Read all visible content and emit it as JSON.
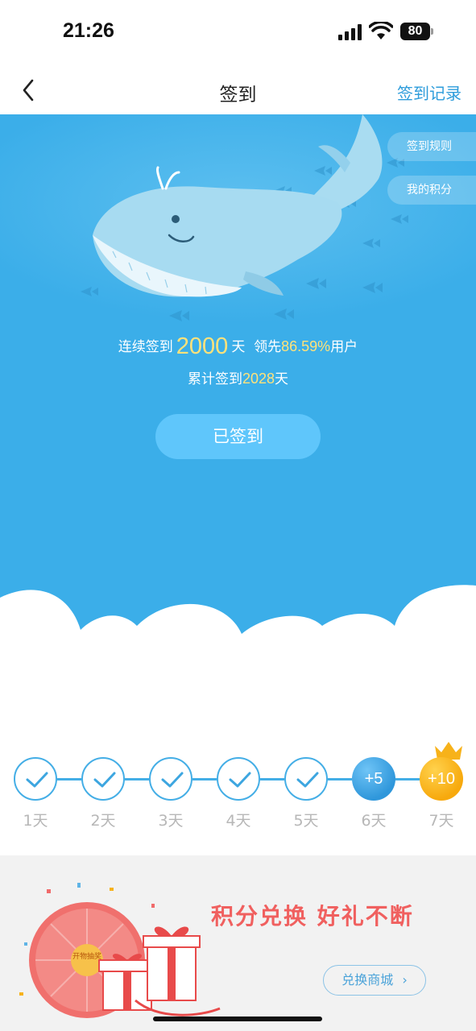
{
  "status_bar": {
    "time": "21:26",
    "battery": "80"
  },
  "nav": {
    "title": "签到",
    "record_link": "签到记录"
  },
  "hero": {
    "side_buttons": {
      "rules": "签到规则",
      "my_points": "我的积分"
    },
    "stats": {
      "streak_prefix": "连续签到",
      "streak_days": "2000",
      "streak_unit": "天",
      "lead_prefix": "领先",
      "lead_percent": "86.59%",
      "lead_suffix": "用户",
      "total_prefix": "累计签到",
      "total_days": "2028",
      "total_unit": "天"
    },
    "checkin_button": "已签到"
  },
  "days": [
    {
      "label": "1天",
      "status": "checked"
    },
    {
      "label": "2天",
      "status": "checked"
    },
    {
      "label": "3天",
      "status": "checked"
    },
    {
      "label": "4天",
      "status": "checked"
    },
    {
      "label": "5天",
      "status": "checked"
    },
    {
      "label": "6天",
      "status": "bonus",
      "bonus": "+5"
    },
    {
      "label": "7天",
      "status": "bonus",
      "bonus": "+10"
    }
  ],
  "promo": {
    "title": "积分兑换 好礼不断",
    "shop_button": "兑换商城",
    "shop_chevron": "›",
    "wheel_center": "开物抽奖"
  },
  "colors": {
    "hero_blue": "#3baee9",
    "accent_yellow": "#ffe27a",
    "check_blue": "#44aee6",
    "gold": "#f7a90d",
    "promo_red": "#f0605f"
  }
}
